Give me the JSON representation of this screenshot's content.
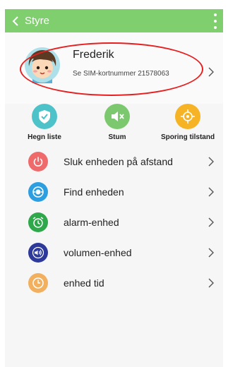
{
  "appbar": {
    "title": "Styre"
  },
  "profile": {
    "name": "Frederik",
    "sim_text": "Se SIM-kortnummer 21578063"
  },
  "quick_actions": [
    {
      "label": "Hegn liste",
      "icon": "shield-check-icon",
      "color": "#4ec2c9"
    },
    {
      "label": "Stum",
      "icon": "speaker-mute-icon",
      "color": "#7cc86f"
    },
    {
      "label": "Sporing tilstand",
      "icon": "crosshair-icon",
      "color": "#f5b325"
    }
  ],
  "menu": [
    {
      "label": "Sluk enheden på afstand",
      "icon": "power-icon",
      "color": "#ef6b6b"
    },
    {
      "label": "Find enheden",
      "icon": "radar-icon",
      "color": "#2d9fe0"
    },
    {
      "label": "alarm-enhed",
      "icon": "alarm-clock-icon",
      "color": "#2ea84b"
    },
    {
      "label": "volumen-enhed",
      "icon": "volume-icon",
      "color": "#2d3a9a"
    },
    {
      "label": "enhed tid",
      "icon": "clock-icon",
      "color": "#f2b05e"
    }
  ]
}
